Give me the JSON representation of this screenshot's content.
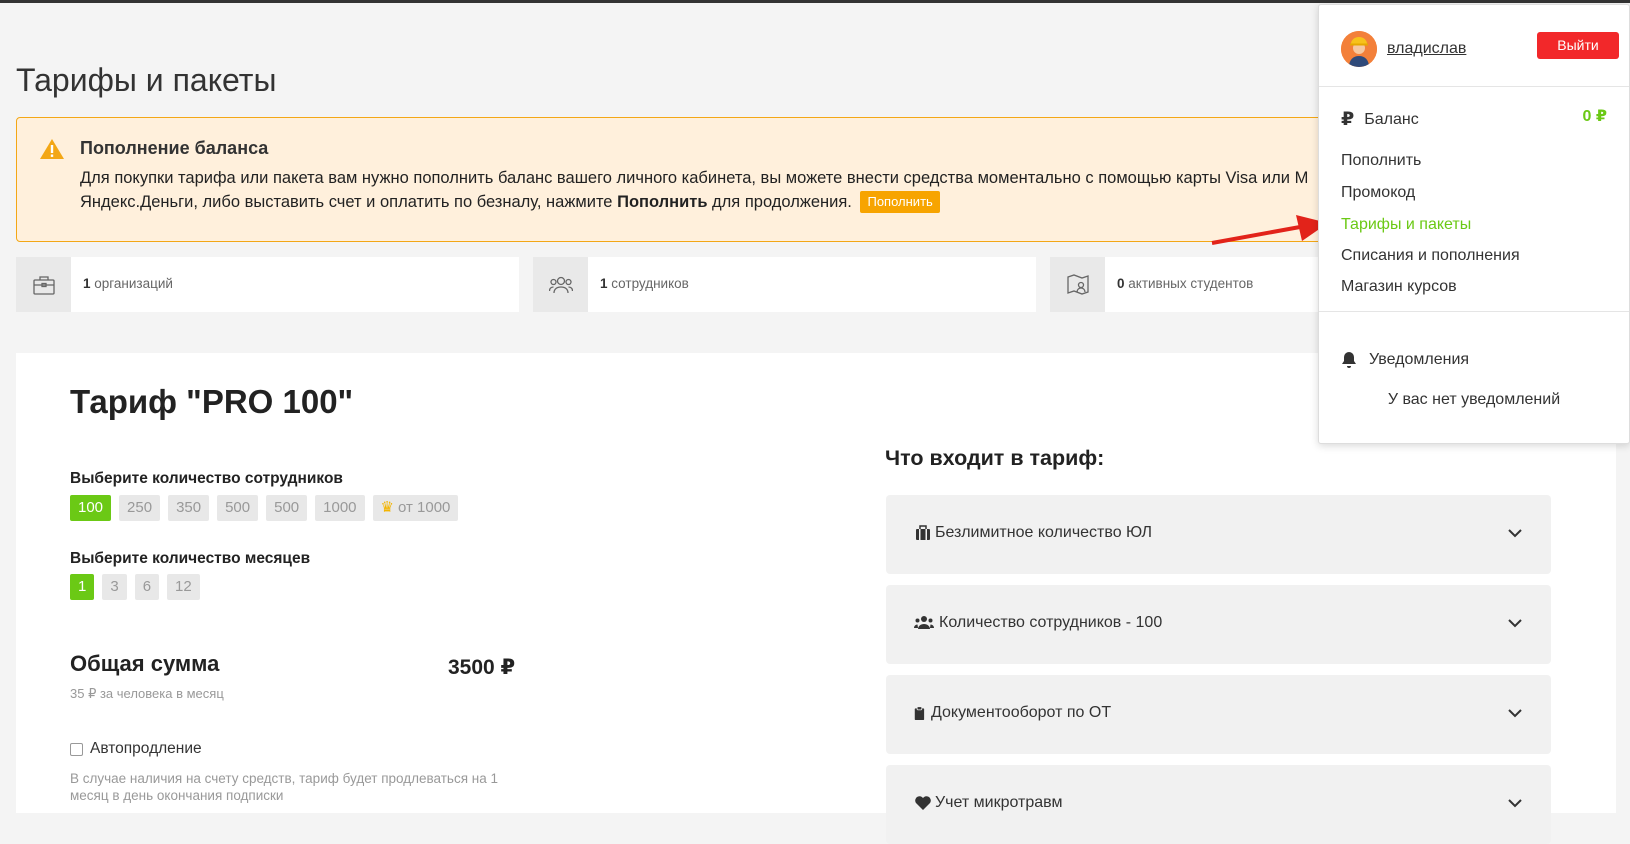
{
  "page": {
    "title": "Тарифы и пакеты"
  },
  "alert": {
    "icon": "warning-icon",
    "title": "Пополнение баланса",
    "text_before": "Для покупки тарифа или пакета вам нужно пополнить баланс вашего личного кабинета, вы можете внести средства моментально с помощью карты Visa или M",
    "text_line2": "Яндекс.Деньги, либо выставить счет и оплатить по безналу, нажмите ",
    "text_bold": "Пополнить",
    "text_after": " для продолжения.",
    "button_label": "Пополнить",
    "accent_color": "#f3a716"
  },
  "stats": [
    {
      "icon": "briefcase-icon",
      "count": "1",
      "label": " организаций"
    },
    {
      "icon": "users-icon",
      "count": "1",
      "label": " сотрудников"
    },
    {
      "icon": "map-student-icon",
      "count": "0",
      "label": " активных студентов"
    }
  ],
  "tariff": {
    "title": "Тариф \"PRO 100\"",
    "employees_label": "Выберите количество сотрудников",
    "employees_options": [
      "100",
      "250",
      "350",
      "500",
      "500",
      "1000"
    ],
    "employees_selected": "100",
    "employees_premium": "от 1000",
    "months_label": "Выберите количество месяцев",
    "months_options": [
      "1",
      "3",
      "6",
      "12"
    ],
    "months_selected": "1",
    "total_label": "Общая сумма",
    "total_sub": "35 ₽ за человека в месяц",
    "total_value": "3500 ₽",
    "autorenew_label": "Автопродление",
    "autorenew_checked": false,
    "renew_note": "В случае наличия на счету средств, тариф будет продлеваться на 1 месяц в день окончания подписки"
  },
  "includes": {
    "title": "Что входит в тариф:",
    "items": [
      {
        "icon": "suitcase-icon",
        "label": "Безлимитное количество ЮЛ"
      },
      {
        "icon": "users-icon",
        "label": "Количество сотрудников - 100"
      },
      {
        "icon": "clipboard-icon",
        "label": "Документооборот по ОТ"
      },
      {
        "icon": "heart-icon",
        "label": "Учет микротравм"
      }
    ]
  },
  "user_menu": {
    "username": "владислав",
    "logout_label": "Выйти",
    "balance_label": "Баланс",
    "balance_value": "0 ₽",
    "balance_icon": "ruble-icon",
    "items": [
      "Пополнить",
      "Промокод",
      "Тарифы и пакеты",
      "Списания и пополнения",
      "Магазин курсов"
    ],
    "active_item": "Тарифы и пакеты",
    "notifications_label": "Уведомления",
    "notifications_empty": "У вас нет уведомлений",
    "accent_green": "#6bc915",
    "logout_color": "#f2282a"
  }
}
